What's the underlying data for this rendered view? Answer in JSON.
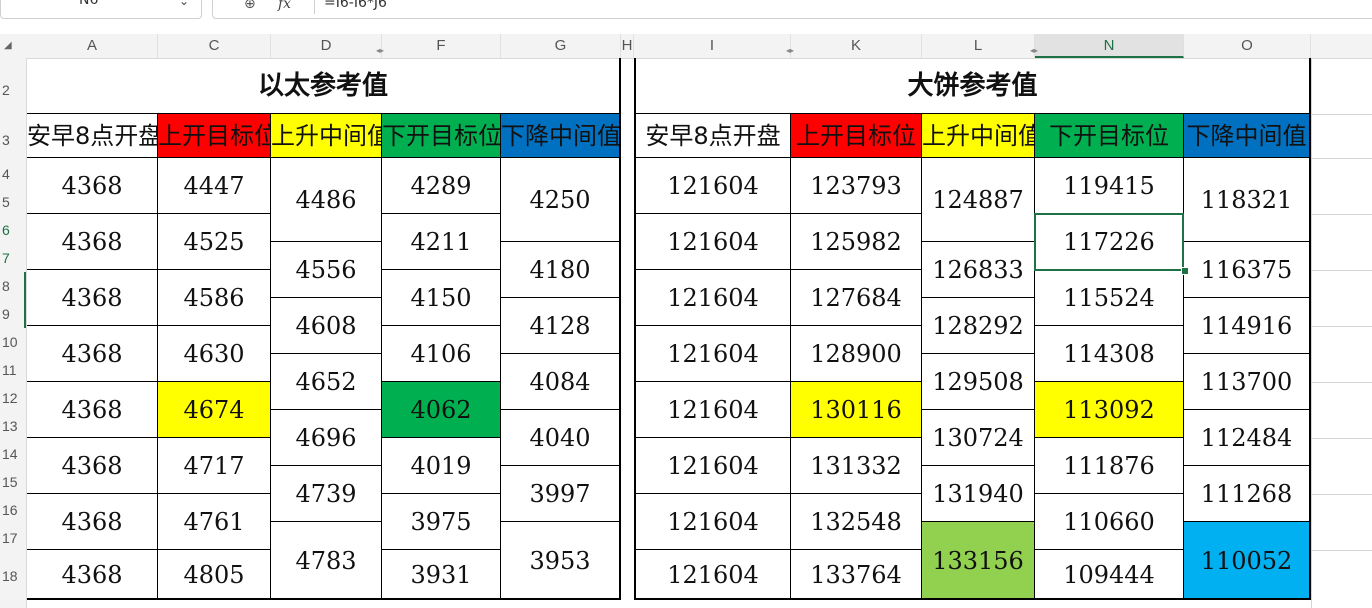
{
  "name_box": "N6",
  "formula": "=I6-I6*J6",
  "icons": {
    "zoom": "zoom-icon",
    "function": "fx-icon"
  },
  "columns": [
    "A",
    "C",
    "D",
    "F",
    "G",
    "H",
    "I",
    "K",
    "L",
    "N",
    "O"
  ],
  "rows": [
    "2",
    "3",
    "4",
    "5",
    "6",
    "7",
    "8",
    "9",
    "10",
    "11",
    "12",
    "13",
    "14",
    "15",
    "16",
    "17",
    "18"
  ],
  "selected_column": "N",
  "selected_rows": [
    "6",
    "7"
  ],
  "colors": {
    "red": "#ff0000",
    "yellow": "#ffff00",
    "green": "#00b050",
    "blue": "#0070c0",
    "light_green": "#92d050",
    "light_blue": "#00b0f0",
    "selection": "#1e7145"
  },
  "eth": {
    "title": "以太参考值",
    "headers": [
      "安早8点开盘",
      "上开目标位",
      "上升中间值",
      "下开目标位",
      "下降中间值"
    ],
    "open": [
      "4368",
      "4368",
      "4368",
      "4368",
      "4368",
      "4368",
      "4368",
      "4368"
    ],
    "up_target": [
      "4447",
      "4525",
      "4586",
      "4630",
      "4674",
      "4717",
      "4761",
      "4805"
    ],
    "up_mid": [
      "4486",
      "4556",
      "4608",
      "4652",
      "4696",
      "4739",
      "4783"
    ],
    "down_target": [
      "4289",
      "4211",
      "4150",
      "4106",
      "4062",
      "4019",
      "3975",
      "3931"
    ],
    "down_mid": [
      "4250",
      "4180",
      "4128",
      "4084",
      "4040",
      "3997",
      "3953"
    ]
  },
  "btc": {
    "title": "大饼参考值",
    "headers": [
      "安早8点开盘",
      "上开目标位",
      "上升中间值",
      "下开目标位",
      "下降中间值"
    ],
    "open": [
      "121604",
      "121604",
      "121604",
      "121604",
      "121604",
      "121604",
      "121604",
      "121604"
    ],
    "up_target": [
      "123793",
      "125982",
      "127684",
      "128900",
      "130116",
      "131332",
      "132548",
      "133764"
    ],
    "up_mid": [
      "124887",
      "126833",
      "128292",
      "129508",
      "130724",
      "131940",
      "133156"
    ],
    "down_target": [
      "119415",
      "117226",
      "115524",
      "114308",
      "113092",
      "111876",
      "110660",
      "109444"
    ],
    "down_mid": [
      "118321",
      "116375",
      "114916",
      "113700",
      "112484",
      "111268",
      "110052"
    ]
  }
}
